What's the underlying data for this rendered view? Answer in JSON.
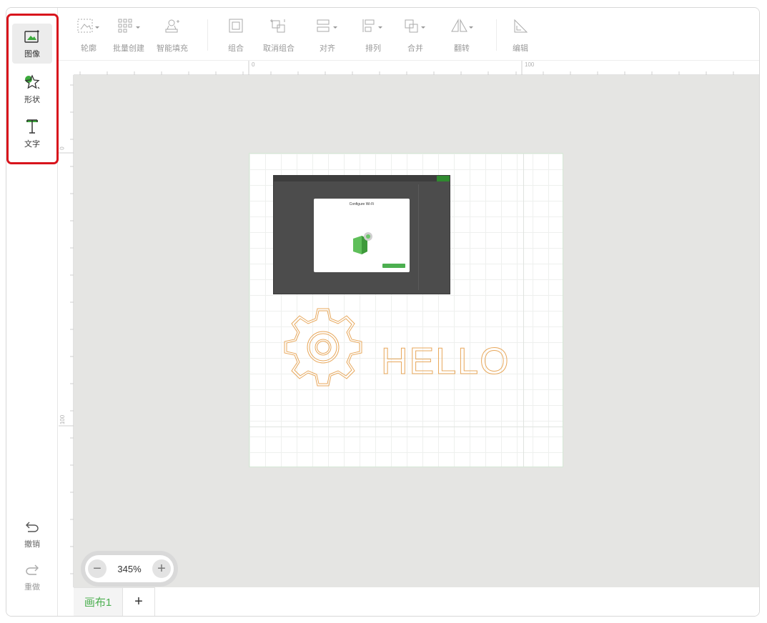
{
  "sidebar": {
    "tools": [
      {
        "label": "图像",
        "icon": "image-icon"
      },
      {
        "label": "形状",
        "icon": "shape-star-icon"
      },
      {
        "label": "文字",
        "icon": "text-icon"
      }
    ],
    "undo_label": "撤销",
    "redo_label": "重做"
  },
  "toolbar": {
    "items": [
      {
        "label": "轮廓",
        "icon": "outline-icon"
      },
      {
        "label": "批量创建",
        "icon": "batch-create-icon"
      },
      {
        "label": "智能填充",
        "icon": "smart-fill-icon"
      },
      {
        "label": "组合",
        "icon": "group-icon"
      },
      {
        "label": "取消组合",
        "icon": "ungroup-icon"
      },
      {
        "label": "对齐",
        "icon": "align-icon"
      },
      {
        "label": "排列",
        "icon": "arrange-icon"
      },
      {
        "label": "合并",
        "icon": "merge-icon"
      },
      {
        "label": "翻转",
        "icon": "flip-icon"
      },
      {
        "label": "编辑",
        "icon": "edit-icon"
      }
    ]
  },
  "rulers": {
    "h_labels": [
      "0",
      "100"
    ],
    "v_labels": [
      "0",
      "100"
    ]
  },
  "canvas": {
    "text_object": "HELLO",
    "embedded_dialog_title": "Configure Wi-Fi"
  },
  "zoom": {
    "value": "345%",
    "minus": "−",
    "plus": "+"
  },
  "tabs": {
    "active_label": "画布1",
    "add_label": "+"
  },
  "colors": {
    "accent_green": "#4caf50",
    "highlight_red": "#d8141c",
    "outline_orange": "#e8a85c",
    "workspace_bg": "#e5e5e3"
  }
}
